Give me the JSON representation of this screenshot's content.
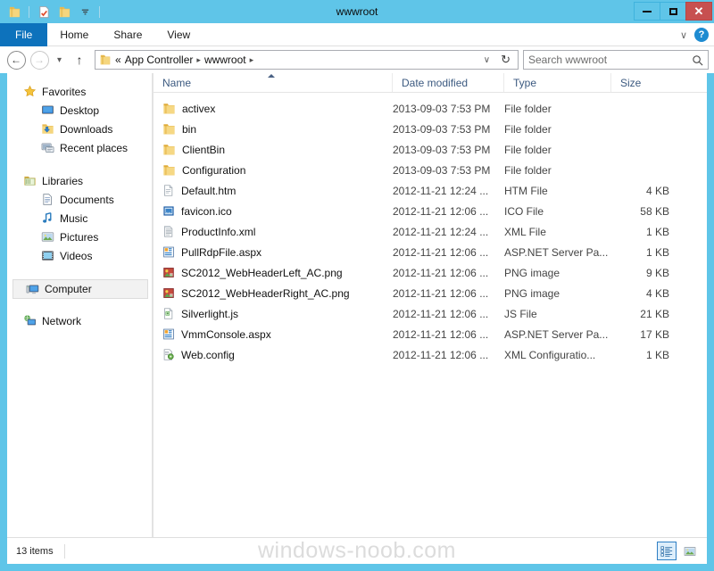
{
  "window": {
    "title": "wwwroot",
    "quick_access": [
      {
        "name": "folder-icon",
        "label": "Folder"
      },
      {
        "name": "properties-icon",
        "label": "Properties"
      },
      {
        "name": "new-folder-icon",
        "label": "New folder"
      },
      {
        "name": "chevron-down-icon",
        "label": "Customize Quick Access Toolbar"
      }
    ],
    "controls": {
      "minimize": "Minimize",
      "maximize": "Maximize",
      "close": "Close"
    },
    "accent_color": "#5fc5e8",
    "close_color": "#c75050",
    "file_tab_color": "#0d72bc"
  },
  "ribbon": {
    "tabs": [
      {
        "label": "File",
        "active": true
      },
      {
        "label": "Home",
        "active": false
      },
      {
        "label": "Share",
        "active": false
      },
      {
        "label": "View",
        "active": false
      }
    ],
    "minimize_ribbon": "∨",
    "help": "?"
  },
  "address": {
    "back": "←",
    "forward": "→",
    "recent": "▾",
    "up": "↑",
    "folder_icon": "folder-icon",
    "prefix": "«",
    "crumbs": [
      "App Controller",
      "wwwroot"
    ],
    "separator": "▸",
    "dropdown": "∨",
    "refresh": "↻"
  },
  "search": {
    "placeholder": "Search wwwroot",
    "icon": "⚲"
  },
  "sidebar": {
    "groups": [
      {
        "header": {
          "label": "Favorites",
          "icon": "star-icon"
        },
        "items": [
          {
            "label": "Desktop",
            "icon": "desktop-icon"
          },
          {
            "label": "Downloads",
            "icon": "downloads-icon"
          },
          {
            "label": "Recent places",
            "icon": "recent-places-icon"
          }
        ]
      },
      {
        "header": {
          "label": "Libraries",
          "icon": "libraries-icon"
        },
        "items": [
          {
            "label": "Documents",
            "icon": "documents-icon"
          },
          {
            "label": "Music",
            "icon": "music-icon"
          },
          {
            "label": "Pictures",
            "icon": "pictures-icon"
          },
          {
            "label": "Videos",
            "icon": "videos-icon"
          }
        ]
      },
      {
        "header": {
          "label": "Computer",
          "icon": "computer-icon",
          "selected": true
        },
        "items": []
      },
      {
        "header": {
          "label": "Network",
          "icon": "network-icon"
        },
        "items": []
      }
    ]
  },
  "filelist": {
    "columns": [
      {
        "label": "Name",
        "sorted": "asc"
      },
      {
        "label": "Date modified",
        "sorted": null
      },
      {
        "label": "Type",
        "sorted": null
      },
      {
        "label": "Size",
        "sorted": null
      }
    ],
    "rows": [
      {
        "name": "activex",
        "date": "2013-09-03 7:53 PM",
        "type": "File folder",
        "size": "",
        "icon": "folder-icon"
      },
      {
        "name": "bin",
        "date": "2013-09-03 7:53 PM",
        "type": "File folder",
        "size": "",
        "icon": "folder-icon"
      },
      {
        "name": "ClientBin",
        "date": "2013-09-03 7:53 PM",
        "type": "File folder",
        "size": "",
        "icon": "folder-icon"
      },
      {
        "name": "Configuration",
        "date": "2013-09-03 7:53 PM",
        "type": "File folder",
        "size": "",
        "icon": "folder-icon"
      },
      {
        "name": "Default.htm",
        "date": "2012-11-21 12:24 ...",
        "type": "HTM File",
        "size": "4 KB",
        "icon": "htm-file-icon"
      },
      {
        "name": "favicon.ico",
        "date": "2012-11-21 12:06 ...",
        "type": "ICO File",
        "size": "58 KB",
        "icon": "ico-file-icon"
      },
      {
        "name": "ProductInfo.xml",
        "date": "2012-11-21 12:24 ...",
        "type": "XML File",
        "size": "1 KB",
        "icon": "xml-file-icon"
      },
      {
        "name": "PullRdpFile.aspx",
        "date": "2012-11-21 12:06 ...",
        "type": "ASP.NET Server Pa...",
        "size": "1 KB",
        "icon": "aspx-file-icon"
      },
      {
        "name": "SC2012_WebHeaderLeft_AC.png",
        "date": "2012-11-21 12:06 ...",
        "type": "PNG image",
        "size": "9 KB",
        "icon": "png-image-icon"
      },
      {
        "name": "SC2012_WebHeaderRight_AC.png",
        "date": "2012-11-21 12:06 ...",
        "type": "PNG image",
        "size": "4 KB",
        "icon": "png-image-icon"
      },
      {
        "name": "Silverlight.js",
        "date": "2012-11-21 12:06 ...",
        "type": "JS File",
        "size": "21 KB",
        "icon": "js-file-icon"
      },
      {
        "name": "VmmConsole.aspx",
        "date": "2012-11-21 12:06 ...",
        "type": "ASP.NET Server Pa...",
        "size": "17 KB",
        "icon": "aspx-file-icon"
      },
      {
        "name": "Web.config",
        "date": "2012-11-21 12:06 ...",
        "type": "XML Configuratio...",
        "size": "1 KB",
        "icon": "config-file-icon"
      }
    ]
  },
  "status": {
    "count": "13 items",
    "watermark": "windows-noob.com",
    "views": [
      {
        "name": "details-view-button",
        "active": true
      },
      {
        "name": "large-icons-view-button",
        "active": false
      }
    ]
  }
}
